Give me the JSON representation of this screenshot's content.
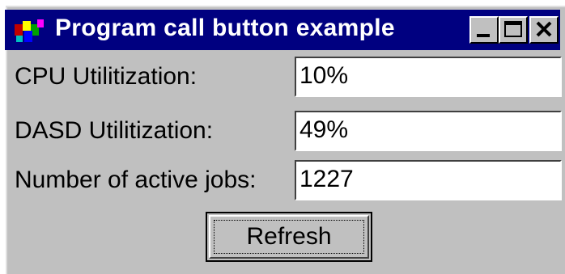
{
  "window": {
    "title": "Program call button example",
    "icon": "java-app-icon",
    "controls": [
      "minimize-icon",
      "maximize-icon",
      "close-icon"
    ]
  },
  "fields": {
    "cpu": {
      "label": "CPU Utilitization:",
      "value": "10%"
    },
    "dasd": {
      "label": "DASD Utilitization:",
      "value": "49%"
    },
    "jobs": {
      "label": "Number of active jobs:",
      "value": "1227"
    }
  },
  "refresh": {
    "label": "Refresh"
  },
  "colors": {
    "titlebar": "#000080",
    "window": "#c0c0c0"
  }
}
